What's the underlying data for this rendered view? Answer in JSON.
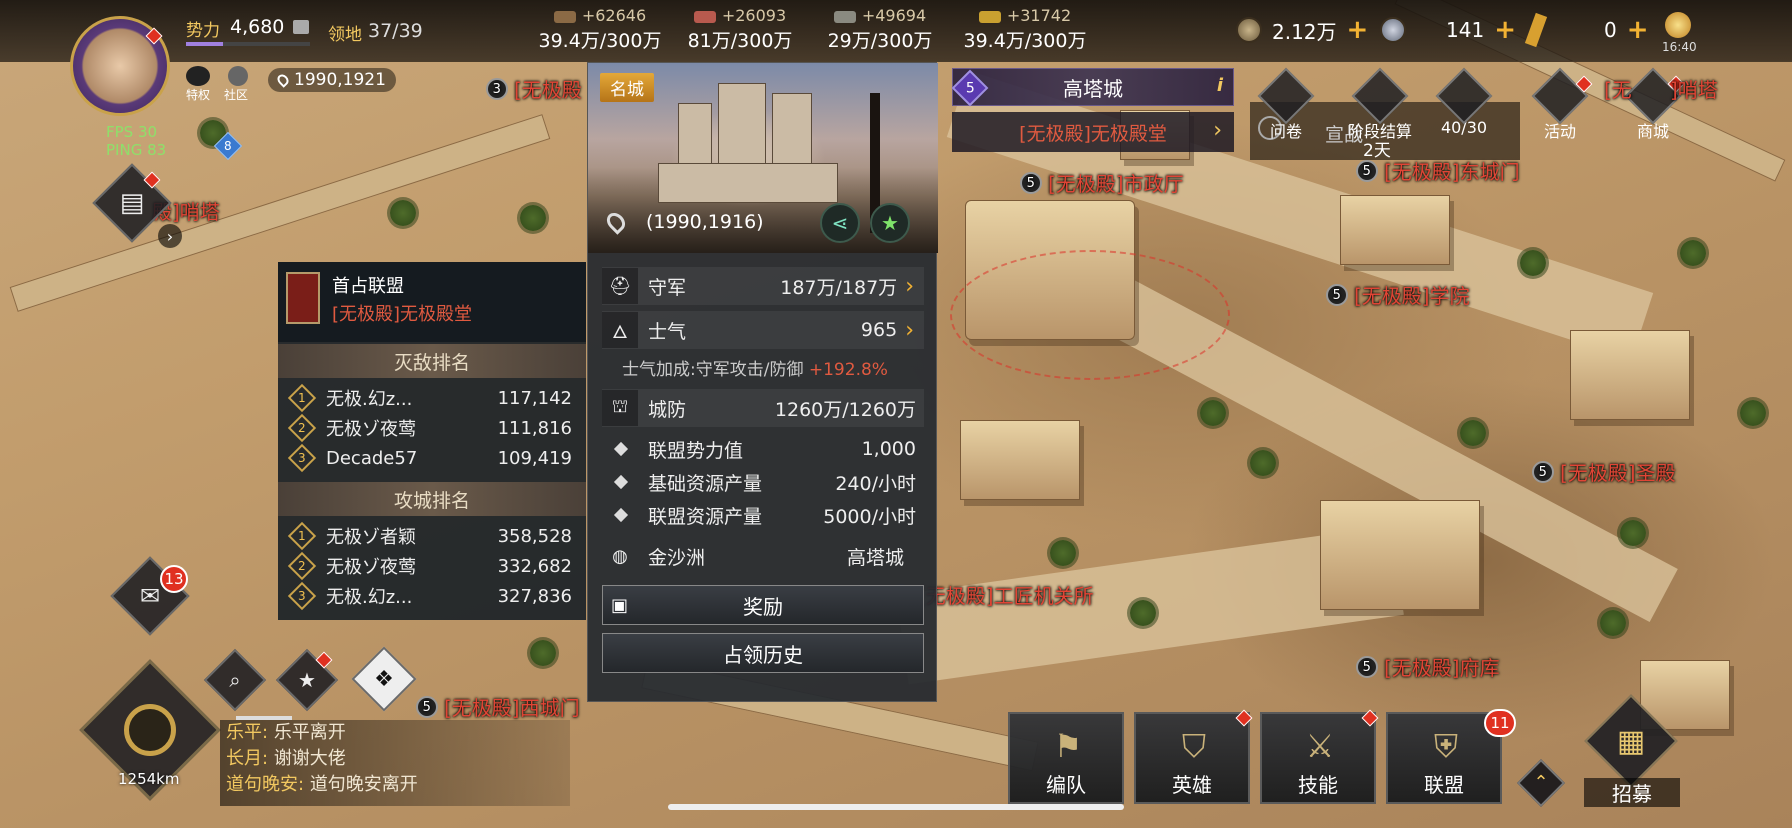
{
  "topbar": {
    "power_label": "势力",
    "power_value": "4,680",
    "territory_label": "领地",
    "territory_value": "37/39",
    "coords": "1990,1921",
    "fps": "FPS 30",
    "ping": "PING 83",
    "ping_level": "8",
    "vip_label": "特权",
    "community_label": "社区",
    "resources": [
      {
        "gain": "+62646",
        "amount": "39.4万/300万",
        "color": "#8b6a45"
      },
      {
        "gain": "+26093",
        "amount": "81万/300万",
        "color": "#b85a4e"
      },
      {
        "gain": "+49694",
        "amount": "29万/300万",
        "color": "#8a8a80"
      },
      {
        "gain": "+31742",
        "amount": "39.4万/300万",
        "color": "#c9a030"
      }
    ],
    "currency1": "2.12万",
    "currency2": "141",
    "currency3": "0",
    "time": "16:40"
  },
  "top_icons": {
    "survey": "问卷",
    "stage_settle": "阶段结算",
    "stage_days": "2天",
    "stage_count": "40/30",
    "stage_ghost": "宣战",
    "activity": "活动",
    "shop": "商城"
  },
  "map_tags": [
    {
      "lvl": "3",
      "text": "[无极殿"
    },
    {
      "lvl": "5",
      "text": "[无极殿]市政厅"
    },
    {
      "lvl": "5",
      "text": "[无极殿]东城门"
    },
    {
      "lvl": "5",
      "text": "[无极殿]学院"
    },
    {
      "lvl": "5",
      "text": "[无极殿]圣殿"
    },
    {
      "lvl": "5",
      "text": "[无极殿]工匠机关所"
    },
    {
      "lvl": "5",
      "text": "[无极殿]府库"
    },
    {
      "lvl": "5",
      "text": "[无极殿]西城门"
    },
    {
      "lvl": "",
      "text": "殿]哨塔"
    },
    {
      "lvl": "",
      "text": "[无"
    },
    {
      "lvl": "",
      "text": "]哨塔"
    }
  ],
  "city": {
    "badge": "名城",
    "level": "5",
    "name": "高塔城",
    "owner": "[无极殿]无极殿堂",
    "coords": "(1990,1916)",
    "garrison_label": "守军",
    "garrison_value": "187万/187万",
    "morale_label": "士气",
    "morale_value": "965",
    "morale_bonus_label": "士气加成:守军攻击/防御",
    "morale_bonus_value": "+192.8%",
    "defense_label": "城防",
    "defense_value": "1260万/1260万",
    "alliance_power_label": "联盟势力值",
    "alliance_power_value": "1,000",
    "base_res_label": "基础资源产量",
    "base_res_value": "240/小时",
    "alliance_res_label": "联盟资源产量",
    "alliance_res_value": "5000/小时",
    "region_label": "金沙洲",
    "region_value": "高塔城",
    "reward_btn": "奖励",
    "history_btn": "占领历史"
  },
  "rank": {
    "first_label": "首占联盟",
    "first_value": "[无极殿]无极殿堂",
    "kill_title": "灭敌排名",
    "kill": [
      {
        "n": "1",
        "name": "无极.幻z...",
        "score": "117,142"
      },
      {
        "n": "2",
        "name": "无极ゾ夜莺",
        "score": "111,816"
      },
      {
        "n": "3",
        "name": "Decade57",
        "score": "109,419"
      }
    ],
    "siege_title": "攻城排名",
    "siege": [
      {
        "n": "1",
        "name": "无极ゾ者颖",
        "score": "358,528"
      },
      {
        "n": "2",
        "name": "无极ゾ夜莺",
        "score": "332,682"
      },
      {
        "n": "3",
        "name": "无极.幻z...",
        "score": "327,836"
      }
    ]
  },
  "left": {
    "mail_count": "13",
    "distance": "1254km"
  },
  "chat": [
    {
      "name": "乐平:",
      "msg": "乐平离开"
    },
    {
      "name": "长月:",
      "msg": "谢谢大佬"
    },
    {
      "name": "道句晚安:",
      "msg": "道句晚安离开"
    }
  ],
  "bottom": {
    "troops": "编队",
    "heroes": "英雄",
    "skills": "技能",
    "alliance": "联盟",
    "alliance_badge": "11",
    "recruit": "招募"
  }
}
